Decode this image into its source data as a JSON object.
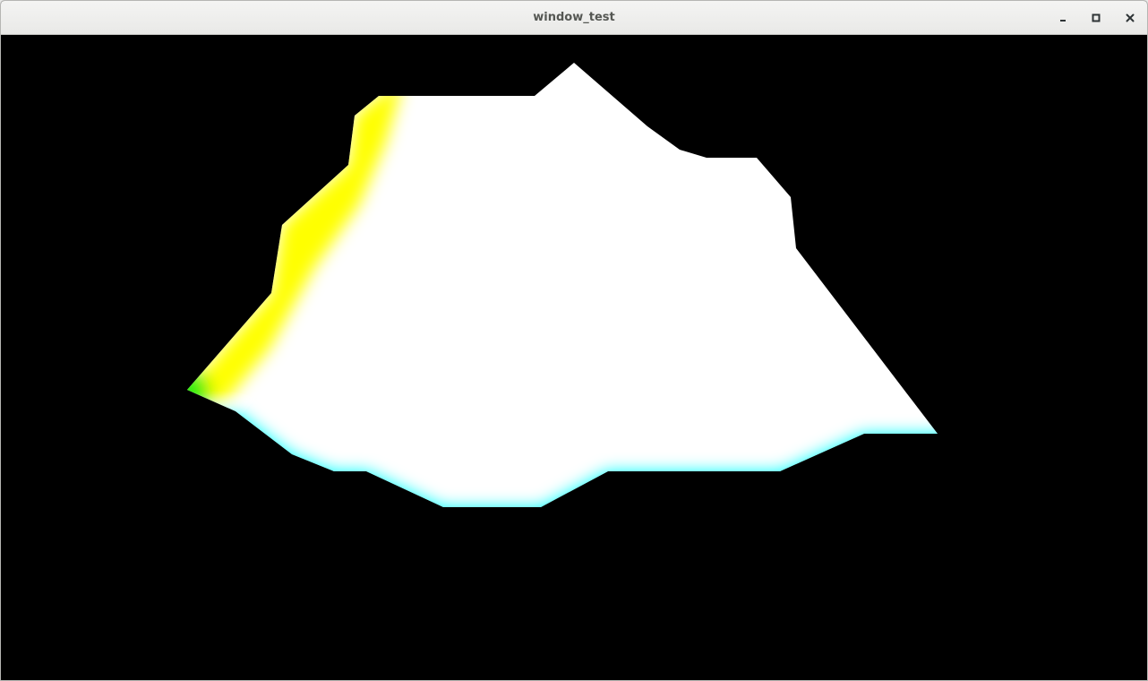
{
  "window": {
    "title": "window_test"
  },
  "titlebar_buttons": {
    "minimize_icon": "minimize-icon",
    "maximize_icon": "maximize-icon",
    "close_icon": "close-icon"
  },
  "scene": {
    "background": "#000000",
    "surface_color": "#ffffff",
    "edge_colors": {
      "left": "#ffff00",
      "bottom": "#00ffff",
      "corner": "#33ee11"
    }
  }
}
